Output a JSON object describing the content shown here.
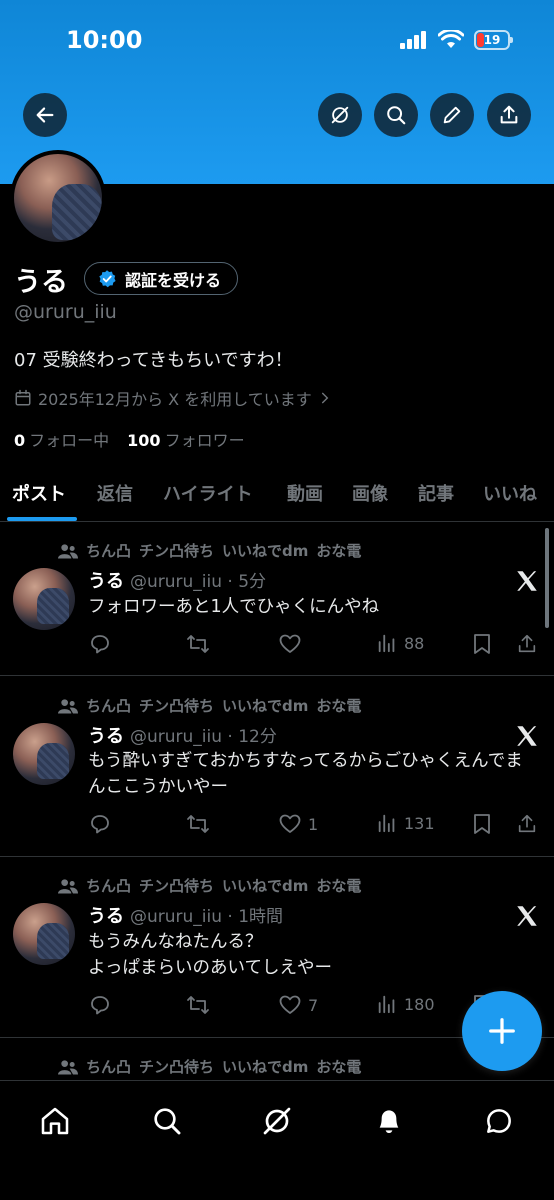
{
  "status_bar": {
    "time": "10:00",
    "battery": "19"
  },
  "profile": {
    "name": "うる",
    "verify_label": "認証を受ける",
    "handle": "@ururu_iiu",
    "bio": "07 受験終わってきもちいですわ！",
    "joined": "2025年12月から X を利用しています",
    "following_count": "0",
    "following_label": "フォロー中",
    "followers_count": "100",
    "followers_label": "フォロワー"
  },
  "tabs": [
    "ポスト",
    "返信",
    "ハイライト",
    "動画",
    "画像",
    "記事",
    "いいね"
  ],
  "social_context": [
    "ちん凸",
    "チン凸待ち",
    "いいねでdm",
    "おな電"
  ],
  "posts": [
    {
      "name": "うる",
      "meta": "@ururu_iiu · 5分",
      "text": "フォロワーあと1人でひゃくにんやね",
      "likes": "",
      "views": "88"
    },
    {
      "name": "うる",
      "meta": "@ururu_iiu · 12分",
      "text": "もう酔いすぎておかちすなってるからごひゃくえんでまんここうかいやー",
      "likes": "1",
      "views": "131"
    },
    {
      "name": "うる",
      "meta": "@ururu_iiu · 1時間",
      "text": "もうみんなねたんる？\nよっぱまらいのあいてしえやー",
      "likes": "7",
      "views": "180"
    }
  ],
  "icons": {
    "back": "back-arrow-icon",
    "grok": "grok-icon",
    "search": "search-icon",
    "edit": "pencil-icon",
    "share": "share-icon",
    "reply": "reply-icon",
    "repost": "repost-icon",
    "like": "heart-icon",
    "views": "views-icon",
    "bookmark": "bookmark-icon",
    "compose": "plus-icon",
    "home": "home-icon",
    "notifications": "bell-icon",
    "messages": "message-icon"
  },
  "colors": {
    "accent": "#1d9bf0",
    "background": "#000000",
    "muted": "#71767b",
    "text": "#e7e9ea"
  }
}
